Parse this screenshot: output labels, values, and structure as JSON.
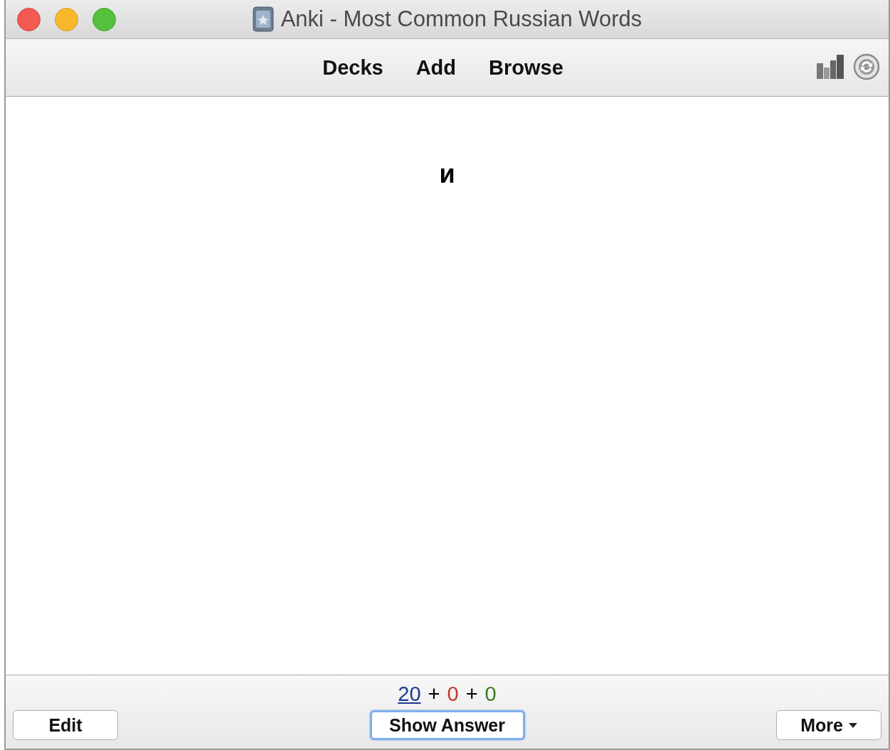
{
  "window": {
    "title": "Anki - Most Common Russian Words"
  },
  "toolbar": {
    "links": [
      "Decks",
      "Add",
      "Browse"
    ]
  },
  "card": {
    "question": "и"
  },
  "bottom_bar": {
    "counts": [
      {
        "text": "20",
        "color": "#1d3a94",
        "kind": "link"
      },
      {
        "text": "0",
        "color": "#c0392b",
        "kind": "plain"
      },
      {
        "text": "0",
        "color": "#3b7a1e",
        "kind": "plain"
      }
    ],
    "separators": [
      "+",
      "+"
    ],
    "buttons": [
      {
        "label": "Edit",
        "kind": "plain",
        "focused": false
      },
      {
        "label": "Show Answer",
        "kind": "plain",
        "focused": true
      },
      {
        "label": "More",
        "kind": "menu",
        "focused": false
      }
    ]
  }
}
